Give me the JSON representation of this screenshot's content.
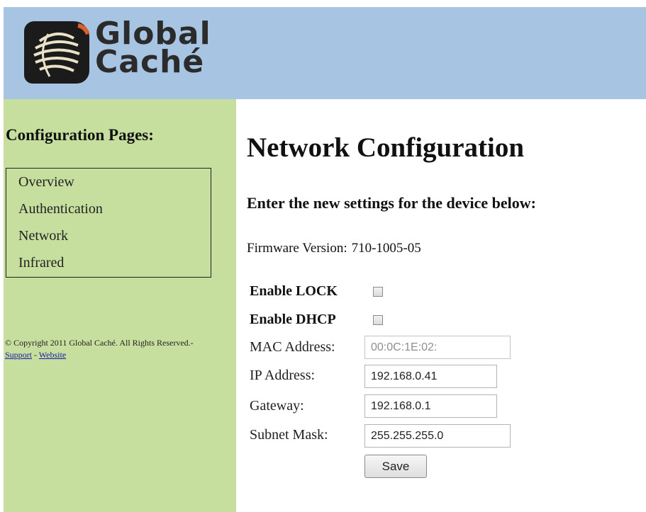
{
  "header": {
    "logo_line1": "Global",
    "logo_line2": "Caché",
    "logo_icon": "global-cache-logo-icon"
  },
  "sidebar": {
    "title": "Configuration Pages:",
    "nav_items": [
      {
        "label": "Overview"
      },
      {
        "label": "Authentication"
      },
      {
        "label": "Network"
      },
      {
        "label": "Infrared"
      }
    ],
    "copyright_text": "© Copyright 2011 Global Caché. All Rights Reserved.- ",
    "support_link": "Support",
    "separator": " - ",
    "website_link": "Website"
  },
  "main": {
    "title": "Network Configuration",
    "subtitle": "Enter the new settings for the device below:",
    "firmware_label": "Firmware Version:",
    "firmware_value": "710-1005-05",
    "enable_lock": {
      "label": "Enable LOCK",
      "checked": false
    },
    "enable_dhcp": {
      "label": "Enable DHCP",
      "checked": false
    },
    "mac": {
      "label": "MAC Address:",
      "value": "00:0C:1E:02:"
    },
    "ip": {
      "label": "IP Address:",
      "value": "192.168.0.41"
    },
    "gateway": {
      "label": "Gateway:",
      "value": "192.168.0.1"
    },
    "subnet": {
      "label": "Subnet Mask:",
      "value": "255.255.255.0"
    },
    "save_label": "Save"
  },
  "colors": {
    "header_bg": "#a7c5e3",
    "sidebar_bg": "#c6df9f",
    "link": "#1a1aa6"
  }
}
